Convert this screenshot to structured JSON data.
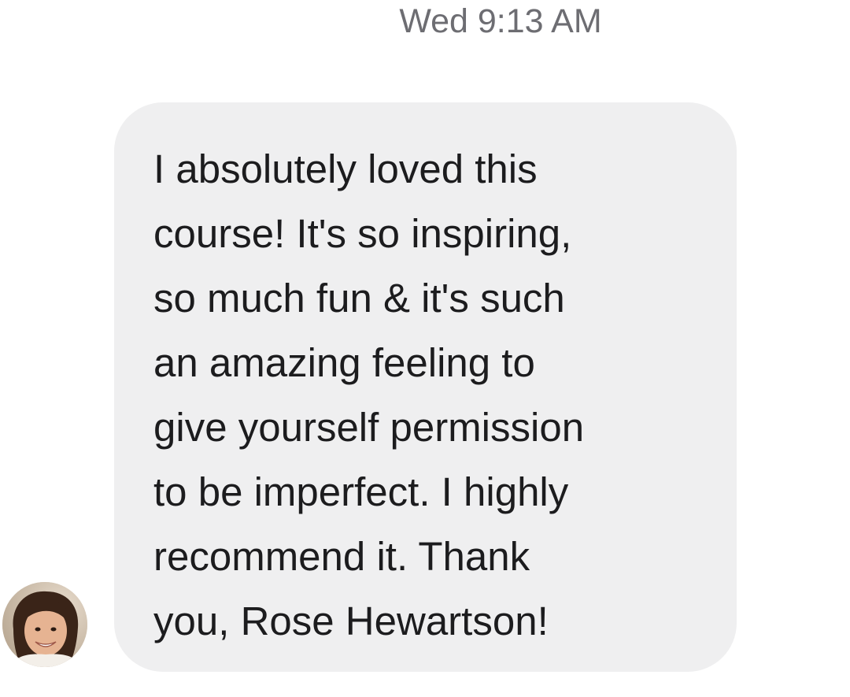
{
  "thread": {
    "timestamp": "Wed 9:13 AM"
  },
  "message": {
    "lines": [
      "I absolutely loved this",
      "course! It's so inspiring,",
      "so much fun & it's such",
      "an amazing feeling to",
      "give yourself permission",
      "to be imperfect. I highly",
      "recommend it. Thank",
      "you, Rose Hewartson!"
    ]
  },
  "sender": {
    "avatar_icon": "person-photo-icon"
  },
  "colors": {
    "page_background": "#ffffff",
    "bubble_background": "#efeff0",
    "message_text": "#1c1c1e",
    "timestamp_text": "#6d6d72"
  }
}
